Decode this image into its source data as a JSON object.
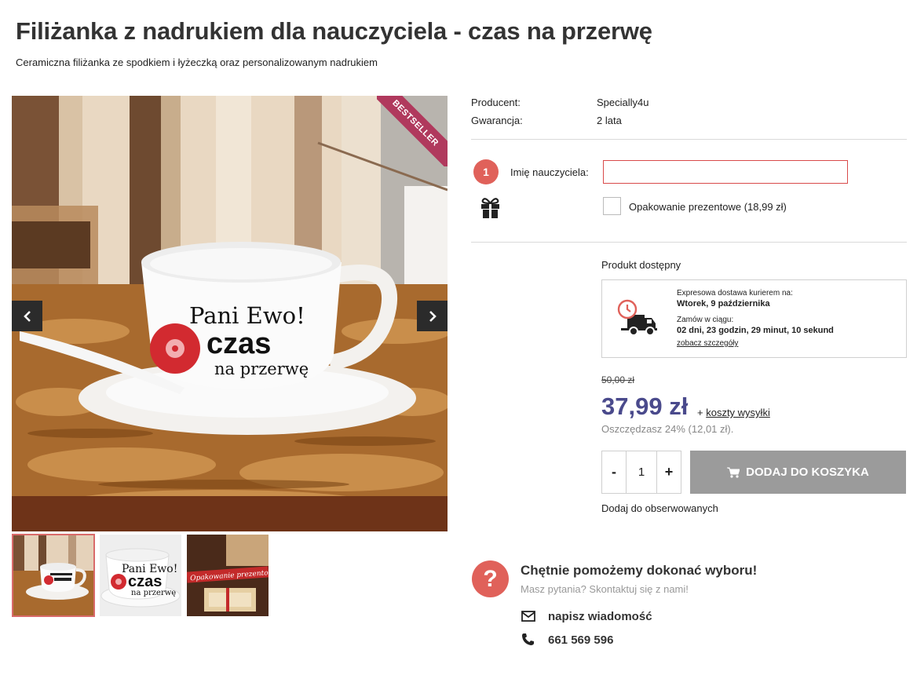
{
  "product": {
    "title": "Filiżanka z nadrukiem dla nauczyciela - czas na przerwę",
    "subtitle": "Ceramiczna filiżanka ze spodkiem i łyżeczką oraz personalizowanym nadrukiem",
    "badge": "BESTSELLER",
    "cup_print": {
      "line1": "Pani Ewo!",
      "line2": "czas",
      "line3": "na przerwę"
    },
    "thumb_gift_label": "Opakowanie prezentowe"
  },
  "specs": [
    {
      "label": "Producent:",
      "value": "Specially4u"
    },
    {
      "label": "Gwarancja:",
      "value": "2 lata"
    }
  ],
  "personalization": {
    "step_number": "1",
    "field_label": "Imię nauczyciela:",
    "field_value": "",
    "gift_wrap_label": "Opakowanie prezentowe (18,99 zł)",
    "gift_wrap_checked": false
  },
  "availability": "Produkt dostępny",
  "delivery": {
    "line1": "Expresowa dostawa kurierem na:",
    "date": "Wtorek, 9 października",
    "line2": "Zamów w ciągu:",
    "countdown": "02 dni, 23 godzin, 29 minut, 10 sekund",
    "details_link": "zobacz szczegóły"
  },
  "pricing": {
    "old_price": "50,00 zł",
    "price": "37,99 zł",
    "shipping_prefix": "+ ",
    "shipping_link": "koszty wysyłki",
    "savings": "Oszczędzasz 24% (12,01 zł)."
  },
  "cart": {
    "minus": "-",
    "quantity": "1",
    "plus": "+",
    "add_label": "DODAJ DO KOSZYKA",
    "watch_label": "Dodaj do obserwowanych"
  },
  "help": {
    "icon_glyph": "?",
    "title": "Chętnie pomożemy dokonać wyboru!",
    "subtitle": "Masz pytania? Skontaktuj się z nami!",
    "message": "napisz wiadomość",
    "phone": "661 569 596"
  },
  "colors": {
    "accent": "#e0615a",
    "price": "#4a4a8c",
    "ribbon": "#b0395d",
    "cart_button": "#9b9b9b"
  }
}
